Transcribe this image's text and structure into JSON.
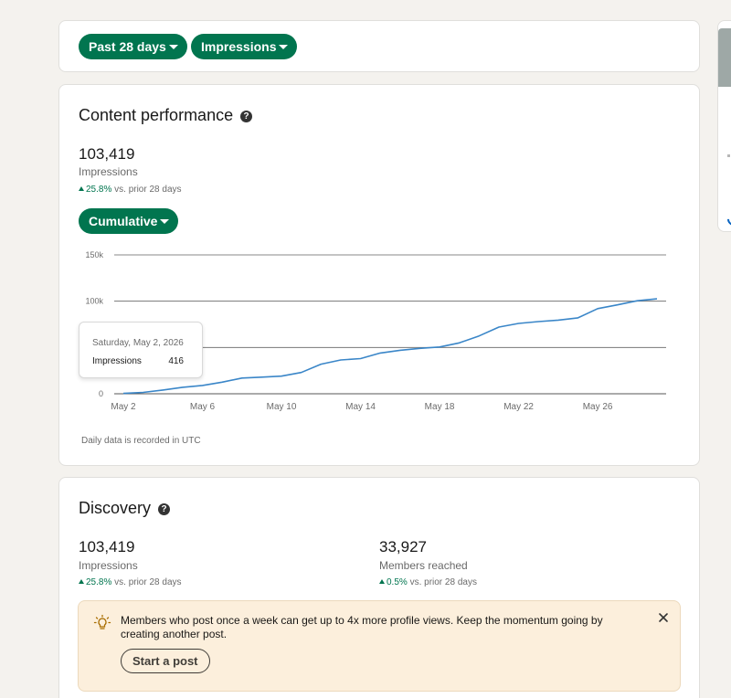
{
  "filters": {
    "range_label": "Past 28 days",
    "metric_label": "Impressions"
  },
  "performance": {
    "title": "Content performance",
    "total": "103,419",
    "total_label": "Impressions",
    "delta_value": "25.8%",
    "delta_text": " vs. prior 28 days",
    "mode_label": "Cumulative",
    "utc_note": "Daily data is recorded in UTC",
    "tooltip": {
      "date": "Saturday, May 2, 2026",
      "label": "Impressions",
      "value": "416"
    }
  },
  "chart_data": {
    "type": "line",
    "x_tick_labels": [
      "May 2",
      "May 6",
      "May 10",
      "May 14",
      "May 18",
      "May 22",
      "May 26"
    ],
    "y_tick_labels": [
      "0",
      "",
      "100k",
      "150k"
    ],
    "ylim": [
      0,
      150000
    ],
    "grid": true,
    "color": "#3a86c8",
    "series": [
      {
        "x": [
          "May 2",
          "May 3",
          "May 4",
          "May 5",
          "May 6",
          "May 7",
          "May 8",
          "May 9",
          "May 10",
          "May 11",
          "May 12",
          "May 13",
          "May 14",
          "May 15",
          "May 16",
          "May 17",
          "May 18",
          "May 19",
          "May 20",
          "May 21",
          "May 22",
          "May 23",
          "May 24",
          "May 25",
          "May 26",
          "May 27",
          "May 28",
          "May 29"
        ],
        "values": [
          416,
          1500,
          4000,
          7000,
          9000,
          12500,
          17000,
          18000,
          19000,
          23000,
          32000,
          36500,
          38000,
          44000,
          47000,
          49000,
          50500,
          55000,
          62500,
          72000,
          76000,
          78000,
          79500,
          82000,
          92000,
          96000,
          100500,
          102500
        ]
      }
    ]
  },
  "discovery": {
    "title": "Discovery",
    "impressions": "103,419",
    "impressions_label": "Impressions",
    "impressions_delta": "25.8%",
    "members": "33,927",
    "members_label": "Members reached",
    "members_delta": "0.5%",
    "delta_text": " vs. prior 28 days",
    "tip_text": "Members who post once a week can get up to 4x more profile views. Keep the momentum going by creating another post.",
    "tip_button": "Start a post"
  },
  "colors": {
    "accent": "#01754f",
    "tip_bg": "#fcefdc",
    "line": "#3a86c8"
  }
}
